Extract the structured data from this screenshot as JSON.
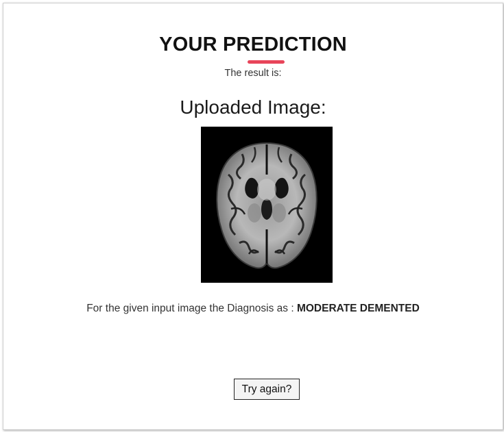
{
  "page": {
    "title": "YOUR PREDICTION",
    "result_label": "The result is:",
    "uploaded_heading": "Uploaded Image:"
  },
  "uploaded_image": {
    "icon": "brain-mri-scan",
    "background_color": "#000000"
  },
  "diagnosis": {
    "prefix": "For the given input image the Diagnosis as :",
    "value": "MODERATE DEMENTED"
  },
  "actions": {
    "try_again_label": "Try again?"
  },
  "colors": {
    "accent": "#e8455a",
    "text": "#333333",
    "title": "#111111"
  }
}
